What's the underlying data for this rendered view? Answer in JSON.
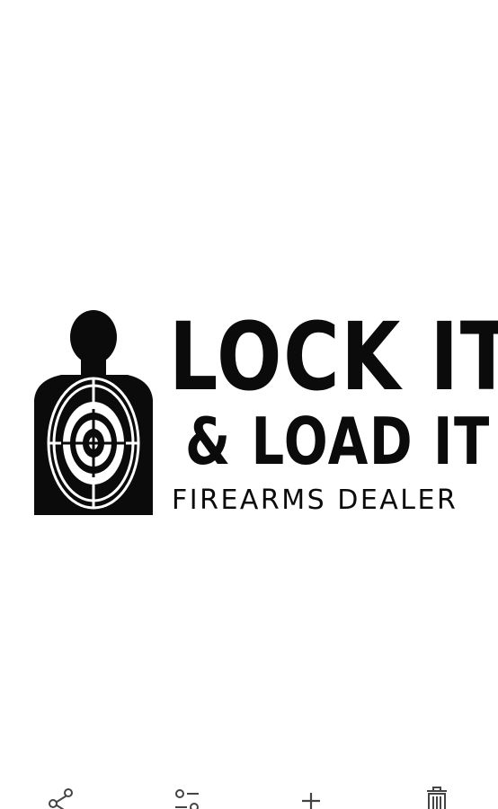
{
  "image": {
    "logo": {
      "line1": "LOCK IT",
      "line2": "& LOAD IT",
      "line3": "FIREARMS DEALER",
      "color": "#0b0b0b"
    }
  },
  "toolbar": {
    "actions": [
      {
        "icon": "share-icon"
      },
      {
        "icon": "adjust-icon"
      },
      {
        "icon": "add-icon"
      },
      {
        "icon": "delete-icon"
      }
    ],
    "icon_color": "#444444"
  }
}
